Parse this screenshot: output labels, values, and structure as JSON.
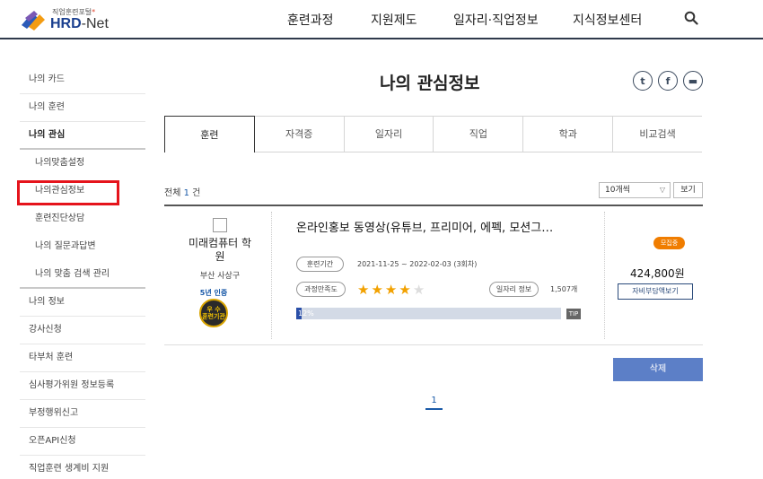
{
  "header": {
    "logo_sub": "직업훈련포털",
    "logo_main_a": "HRD",
    "logo_main_b": "-Net",
    "nav": [
      "훈련과정",
      "지원제도",
      "일자리·직업정보",
      "지식정보센터"
    ],
    "search_icon": "search-icon"
  },
  "sidebar": {
    "items": [
      {
        "label": "나의 카드",
        "type": "top"
      },
      {
        "label": "나의 훈련",
        "type": "top"
      },
      {
        "label": "나의 관심",
        "type": "active"
      },
      {
        "label": "나의맞춤설정",
        "type": "sub"
      },
      {
        "label": "나의관심정보",
        "type": "sub-highlight"
      },
      {
        "label": "훈련진단상담",
        "type": "sub"
      },
      {
        "label": "나의 질문과답변",
        "type": "sub"
      },
      {
        "label": "나의 맞춤 검색 관리",
        "type": "sub-last"
      },
      {
        "label": "나의 정보",
        "type": "top"
      },
      {
        "label": "강사신청",
        "type": "top"
      },
      {
        "label": "타부처 훈련",
        "type": "top"
      },
      {
        "label": "심사평가위원 정보등록",
        "type": "top"
      },
      {
        "label": "부정행위신고",
        "type": "top"
      },
      {
        "label": "오픈API신청",
        "type": "top"
      },
      {
        "label": "직업훈련 생계비 지원",
        "type": "top"
      }
    ]
  },
  "main": {
    "title": "나의 관심정보",
    "sns": [
      {
        "icon": "twitter-icon",
        "glyph": "t"
      },
      {
        "icon": "facebook-icon",
        "glyph": "f"
      },
      {
        "icon": "bus-icon",
        "glyph": "▬"
      }
    ],
    "tabs": [
      "훈련",
      "자격증",
      "일자리",
      "직업",
      "학과",
      "비교검색"
    ],
    "active_tab": 0,
    "total_prefix": "전체",
    "total_count": "1",
    "total_suffix": "건",
    "page_size": "10개씩",
    "view_label": "보기",
    "result": {
      "org_name": "미래컴퓨터 학원",
      "org_location": "부산 사상구",
      "cert_label": "5년 인증",
      "cert_badge_top": "우 수",
      "cert_badge_bottom": "훈련기관",
      "course_title": "온라인홍보 동영상(유튜브, 프리미어, 에펙, 모션그…",
      "period_label": "훈련기간",
      "period_value": "2021-11-25 ~ 2022-02-03 (3회차)",
      "satisfaction_label": "과정만족도",
      "rating": 4,
      "rating_max": 5,
      "jobs_label": "일자리 정보",
      "jobs_count": "1,507개",
      "progress_text": "12%",
      "progress_value": 0.02,
      "tip_label": "TIP",
      "status": "모집중",
      "price": "424,800원",
      "calc_label": "자비부담액보기"
    },
    "delete_label": "삭제",
    "page": "1"
  }
}
